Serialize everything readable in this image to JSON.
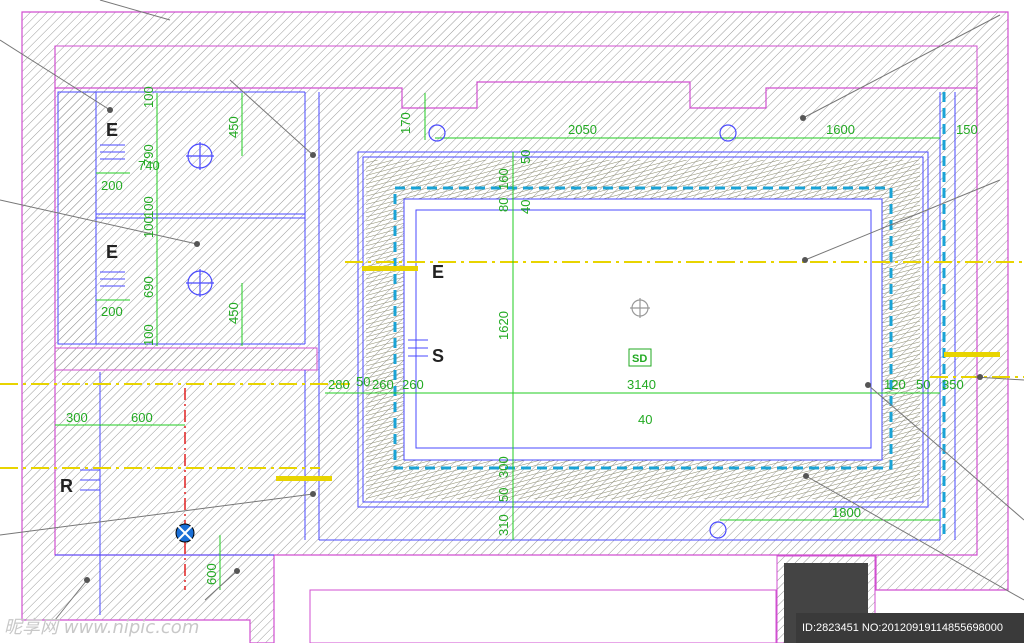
{
  "plan": {
    "labels": [
      {
        "id": "E1",
        "text": "E"
      },
      {
        "id": "E2",
        "text": "E"
      },
      {
        "id": "E3",
        "text": "E"
      },
      {
        "id": "S1",
        "text": "S"
      },
      {
        "id": "R1",
        "text": "R"
      },
      {
        "id": "SD",
        "text": "SD"
      }
    ],
    "dimensions": [
      {
        "id": "d2050",
        "text": "2050"
      },
      {
        "id": "d1600",
        "text": "1600"
      },
      {
        "id": "d150",
        "text": "150"
      },
      {
        "id": "d170",
        "text": "170"
      },
      {
        "id": "d100a",
        "text": "100"
      },
      {
        "id": "d790",
        "text": "790"
      },
      {
        "id": "d740",
        "text": "740"
      },
      {
        "id": "d450a",
        "text": "450"
      },
      {
        "id": "d200a",
        "text": "200"
      },
      {
        "id": "d100b",
        "text": "100"
      },
      {
        "id": "d100c",
        "text": "100"
      },
      {
        "id": "d690",
        "text": "690"
      },
      {
        "id": "d450b",
        "text": "450"
      },
      {
        "id": "d200b",
        "text": "200"
      },
      {
        "id": "d100d",
        "text": "100"
      },
      {
        "id": "d300",
        "text": "300"
      },
      {
        "id": "d600a",
        "text": "600"
      },
      {
        "id": "d600b",
        "text": "600"
      },
      {
        "id": "d280",
        "text": "280"
      },
      {
        "id": "d50a",
        "text": "50"
      },
      {
        "id": "d260",
        "text": "260"
      },
      {
        "id": "d260b",
        "text": "260"
      },
      {
        "id": "d3140",
        "text": "3140"
      },
      {
        "id": "d120",
        "text": "120"
      },
      {
        "id": "d50b",
        "text": "50"
      },
      {
        "id": "d350",
        "text": "350"
      },
      {
        "id": "d1620",
        "text": "1620"
      },
      {
        "id": "d40a",
        "text": "40"
      },
      {
        "id": "d40b",
        "text": "40"
      },
      {
        "id": "d50c",
        "text": "50"
      },
      {
        "id": "d160",
        "text": "160"
      },
      {
        "id": "d80",
        "text": "80"
      },
      {
        "id": "d310",
        "text": "310"
      },
      {
        "id": "d50d",
        "text": "50"
      },
      {
        "id": "d1800",
        "text": "1800"
      },
      {
        "id": "d300b",
        "text": "300"
      }
    ]
  },
  "watermark": "昵享网 www.nipic.com",
  "id_caption": "ID:2823451 NO:20120919114855698000",
  "colors": {
    "wall_outline": "#d04fd0",
    "hatch": "#9a9a9a",
    "ceiling_line": "#4a4aff",
    "dimension": "#22cc22",
    "light_strip": "#1aa3d6",
    "center_axis": "#e8d400",
    "leader": "#777777",
    "red_axis": "#e02020"
  }
}
